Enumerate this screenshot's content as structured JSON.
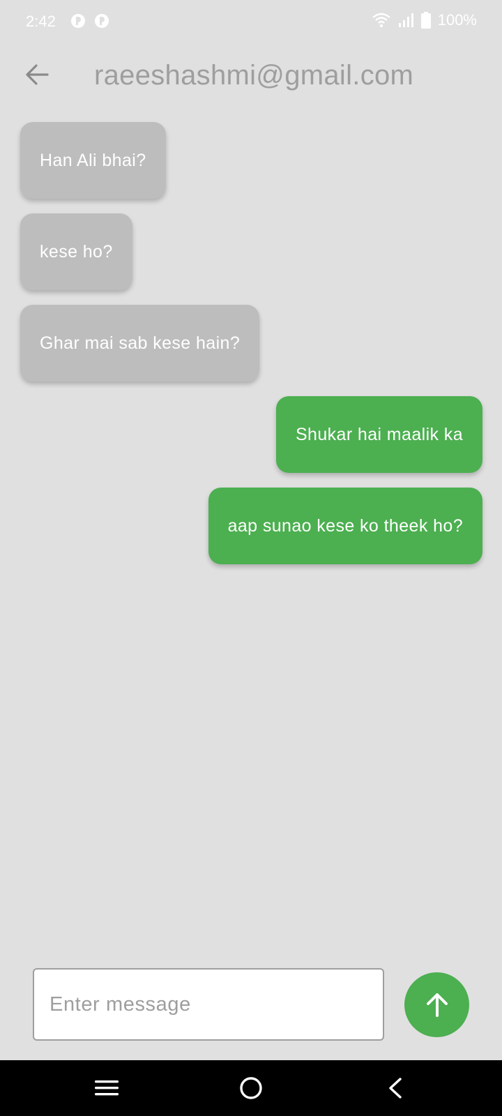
{
  "status_bar": {
    "time": "2:42",
    "battery": "100%",
    "icons": [
      "notification-icon",
      "notification-icon",
      "wifi-icon",
      "signal-icon",
      "battery-icon"
    ]
  },
  "header": {
    "title": "raeeshashmi@gmail.com",
    "back_icon": "arrow-back-icon"
  },
  "messages": [
    {
      "text": "Han Ali bhai?",
      "direction": "received"
    },
    {
      "text": "kese ho?",
      "direction": "received"
    },
    {
      "text": "Ghar mai sab kese hain?",
      "direction": "received"
    },
    {
      "text": "Shukar hai maalik ka",
      "direction": "sent"
    },
    {
      "text": "aap sunao kese ko theek ho?",
      "direction": "sent"
    }
  ],
  "composer": {
    "placeholder": "Enter message",
    "value": "",
    "send_icon": "arrow-up-icon"
  },
  "nav_bar": {
    "icons": [
      "menu-icon",
      "home-icon",
      "back-icon"
    ]
  },
  "colors": {
    "background": "#e0e0e0",
    "received_bubble": "#bdbdbd",
    "sent_bubble": "#4caf50",
    "accent": "#4caf50"
  }
}
